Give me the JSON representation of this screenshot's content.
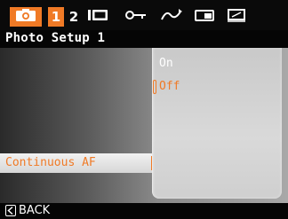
{
  "tabs": [
    {
      "name": "photo",
      "icon": "camera-icon",
      "active": true
    },
    {
      "name": "page-1",
      "label": "1",
      "active": true
    },
    {
      "name": "page-2",
      "label": "2",
      "active": false
    },
    {
      "name": "display",
      "icon": "screen-icon",
      "active": false
    },
    {
      "name": "key",
      "icon": "key-icon",
      "active": false
    },
    {
      "name": "curve",
      "icon": "wave-icon",
      "active": false
    },
    {
      "name": "print",
      "icon": "printer-icon",
      "active": false
    },
    {
      "name": "setup",
      "icon": "tv-icon",
      "active": false
    }
  ],
  "header": {
    "title": "Photo Setup 1"
  },
  "menu": {
    "selected_item": "Continuous AF"
  },
  "options": {
    "items": [
      "On",
      "Off"
    ],
    "selected": "Off"
  },
  "footer": {
    "back_label": "BACK"
  },
  "colors": {
    "accent": "#f07a26",
    "background_dark": "#0a0a0a",
    "popup": "#d3d3d3"
  }
}
